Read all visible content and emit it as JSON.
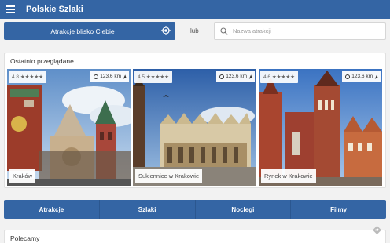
{
  "app": {
    "title": "Polskie Szlaki"
  },
  "nearby": {
    "button_label": "Atrakcje blisko Ciebie"
  },
  "or_label": "lub",
  "search": {
    "placeholder": "Nazwa atrakcji",
    "value": ""
  },
  "recent": {
    "title": "Ostatnio przeglądane",
    "cards": [
      {
        "rating_value": "4.8",
        "stars": "★★★★★",
        "distance": "123.6 km",
        "name": "Kraków"
      },
      {
        "rating_value": "4.5",
        "stars": "★★★★★",
        "distance": "123.6 km",
        "name": "Sukiennice w Krakowie"
      },
      {
        "rating_value": "4.6",
        "stars": "★★★★★",
        "distance": "123.6 km",
        "name": "Rynek w Krakowie"
      }
    ]
  },
  "tabs": [
    {
      "label": "Atrakcje"
    },
    {
      "label": "Szlaki"
    },
    {
      "label": "Noclegi"
    },
    {
      "label": "Filmy"
    }
  ],
  "recommended": {
    "title": "Polecamy"
  },
  "colors": {
    "primary": "#3465a4",
    "background": "#f2f2f2"
  },
  "icons": [
    "menu-icon",
    "target-icon",
    "search-icon",
    "location-pin-icon",
    "navigation-arrow-icon",
    "directions-icon"
  ]
}
